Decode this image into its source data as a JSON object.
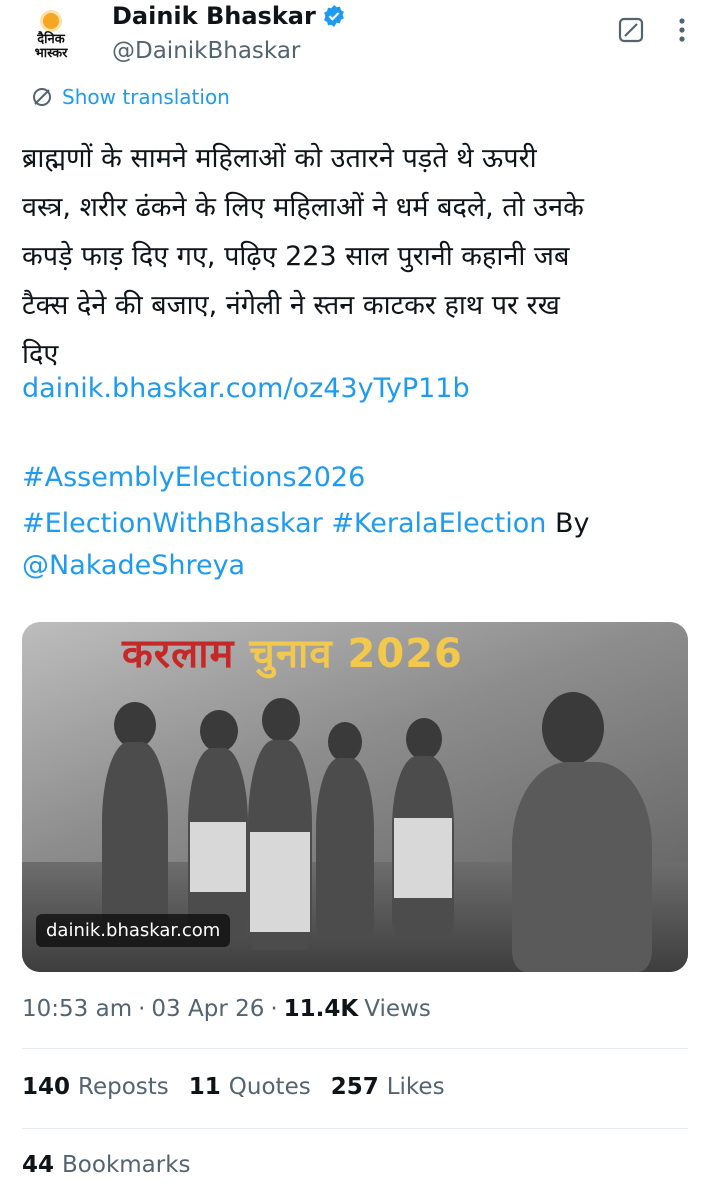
{
  "author": {
    "display_name": "Dainik Bhaskar",
    "handle": "@DainikBhaskar",
    "logo_text_line1": "दैनिक",
    "logo_text_line2": "भास्कर",
    "verified_icon": "verified-badge-icon"
  },
  "actions": {
    "show_translation": "Show translation"
  },
  "tweet": {
    "text": "ब्राह्मणों के सामने महिलाओं को उतारने पड़ते थे ऊपरी\nवस्त्र, शरीर ढंकने के लिए महिलाओं ने धर्म बदले, तो उनके\nकपड़े फाड़ दिए गए, पढ़िए 223 साल पुरानी कहानी जब\nटैक्स देने की बजाए, नंगेली ने स्तन काटकर हाथ पर रख\nदिए",
    "link": "dainik.bhaskar.com/oz43yTyP11b",
    "hashtag1": "#AssemblyElections2026",
    "hashtag2": "#ElectionWithBhaskar",
    "hashtag3": "#KeralaElection",
    "by_text": "By",
    "mention": "@NakadeShreya"
  },
  "media": {
    "title_red": "करलाम",
    "title_yellow": "चुनाव 2026",
    "domain": "dainik.bhaskar.com"
  },
  "meta": {
    "time": "10:53 am",
    "date": "03 Apr 26",
    "views_count": "11.4K",
    "views_label": "Views",
    "separator": "·"
  },
  "stats": {
    "reposts_count": "140",
    "reposts_label": "Reposts",
    "quotes_count": "11",
    "quotes_label": "Quotes",
    "likes_count": "257",
    "likes_label": "Likes",
    "bookmarks_count": "44",
    "bookmarks_label": "Bookmarks"
  },
  "colors": {
    "link": "#1d9bf0",
    "secondary_text": "#536471",
    "primary_text": "#0f1419"
  }
}
